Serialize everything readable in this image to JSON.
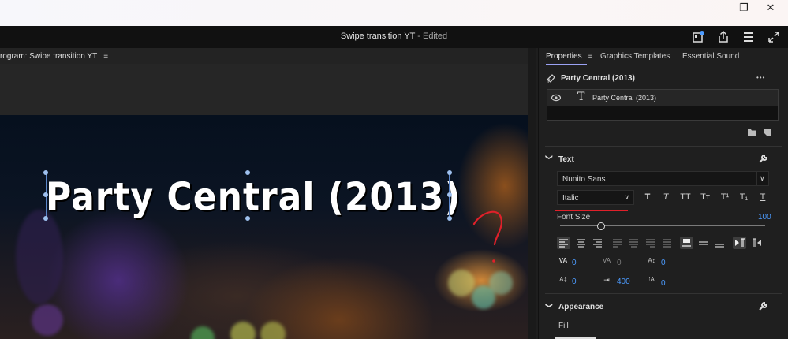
{
  "window": {
    "minimize": "—",
    "restore": "❐",
    "close": "✕"
  },
  "app_bar": {
    "title": "Swipe transition YT",
    "subtitle": " - Edited"
  },
  "program_monitor": {
    "label": "rogram:  Swipe transition YT",
    "menu": "≡"
  },
  "video": {
    "title_text": "Party Central (2013)"
  },
  "annotation": {
    "color": "#e0202a"
  },
  "panel": {
    "tabs": [
      {
        "label": "Properties",
        "menu": "≡"
      },
      {
        "label": "Graphics Templates"
      },
      {
        "label": "Essential Sound"
      }
    ],
    "clip_name": "Party Central (2013)",
    "more_glyph": "•••",
    "layer_name": "Party Central (2013)",
    "text_section": {
      "title": "Text",
      "font_family": "Nunito Sans",
      "font_style": "Italic",
      "style_buttons": [
        "T",
        "T",
        "TT",
        "Tт",
        "T¹",
        "T₁",
        "T"
      ],
      "font_size_label": "Font Size",
      "font_size_value": "100",
      "font_size_fraction": 0.2,
      "tracking_value": "0",
      "kerning_value": "0",
      "baseline_value": "0",
      "leading_value": "0",
      "tab_value": "400",
      "tsume_value": "0"
    },
    "appearance_section": {
      "title": "Appearance",
      "fill_label": "Fill"
    },
    "accent_color": "#4c9bff"
  }
}
